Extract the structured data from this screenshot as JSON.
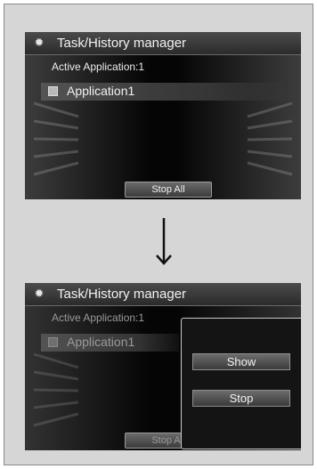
{
  "screen1": {
    "title": "Task/History manager",
    "active_label": "Active Application:1",
    "app_item": "Application1",
    "stop_all": "Stop All"
  },
  "screen2": {
    "title": "Task/History manager",
    "active_label": "Active Application:1",
    "app_item": "Application1",
    "stop_all": "Stop All",
    "popup": {
      "show_label": "Show",
      "stop_label": "Stop"
    }
  },
  "colors": {
    "screen_bg": "#050505",
    "frame_bg": "#d6d6d6",
    "button": "#4a4a4a"
  },
  "icons": [
    "gear-icon",
    "down-arrow-icon",
    "checkbox-icon"
  ]
}
